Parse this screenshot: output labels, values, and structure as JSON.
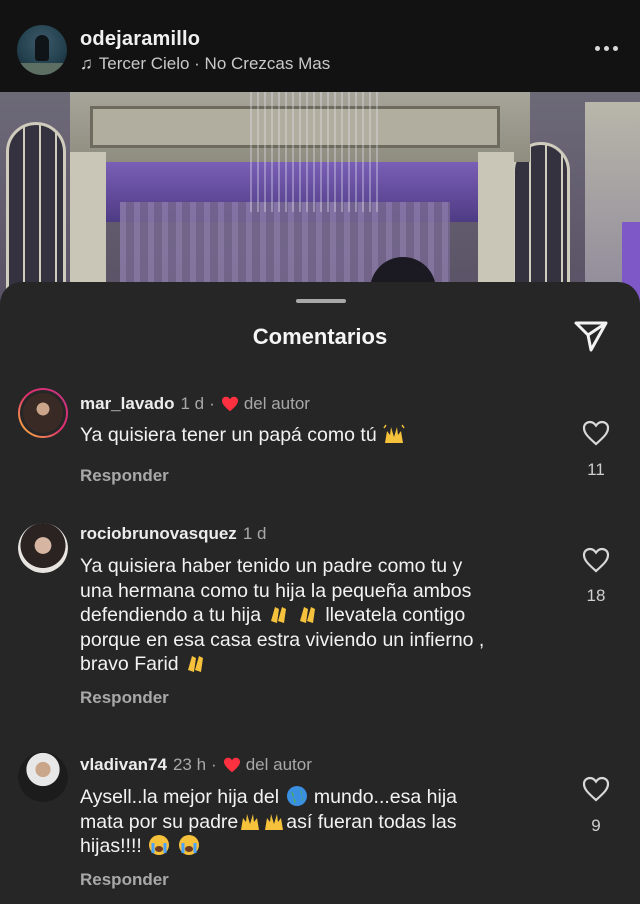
{
  "header": {
    "username": "odejaramillo",
    "song": "Tercer Cielo · No Crezcas Mas",
    "song_icon": "music-note-icon",
    "more_icon": "more-horizontal-icon"
  },
  "sheet": {
    "title": "Comentarios",
    "share_icon": "paper-plane-icon"
  },
  "comments": [
    {
      "username": "mar_lavado",
      "time": "1 d",
      "author_badge": "del autor",
      "text": "Ya quisiera tener un papá como tú",
      "emoji": [
        "raising-hands-emoji"
      ],
      "reply_label": "Responder",
      "likes": "11"
    },
    {
      "username": "rociobrunovasquez",
      "time": "1 d",
      "text_lines": [
        "Ya quisiera haber tenido un padre  como tu y",
        "una hermana como tu hija la pequeña ambos",
        "defendiendo a tu hija",
        "llevatela contigo",
        "porque en esa casa estra viviendo un infierno ,",
        "bravo Farid"
      ],
      "emoji": [
        "clapping-hands-emoji",
        "clapping-hands-emoji",
        "clapping-hands-emoji"
      ],
      "reply_label": "Responder",
      "likes": "18"
    },
    {
      "username": "vladivan74",
      "time": "23 h",
      "author_badge": "del autor",
      "text_parts": [
        "Aysell..la mejor hija del",
        "mundo...esa hija",
        "mata por su padre",
        "así fueran todas las",
        "hijas!!!!"
      ],
      "emoji": [
        "globe-emoji",
        "raising-hands-emoji",
        "raising-hands-emoji",
        "crying-face-emoji",
        "crying-face-emoji"
      ],
      "reply_label": "Responder",
      "likes": "9"
    }
  ],
  "colors": {
    "sheet_bg": "#262626",
    "header_bg": "#121212",
    "muted_text": "#a8a8a8",
    "heart_red": "#ff3040"
  }
}
